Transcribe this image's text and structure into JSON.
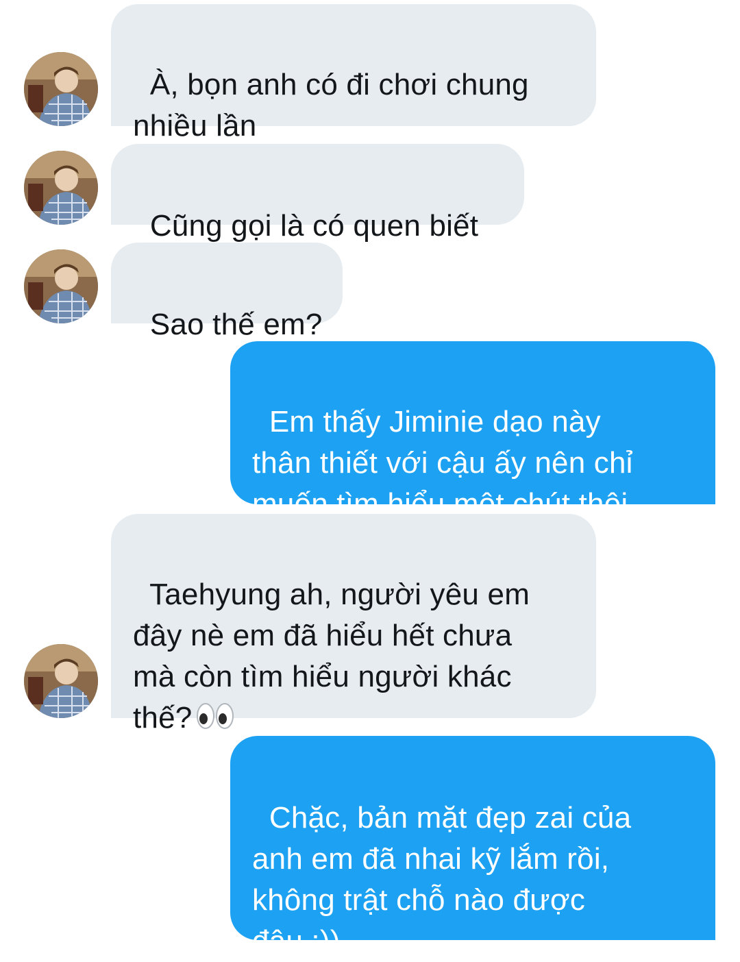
{
  "conversation": {
    "messages": [
      {
        "side": "incoming",
        "text": "À, bọn anh có đi chơi chung\nnhiều lần"
      },
      {
        "side": "incoming",
        "text": "Cũng gọi là có quen biết"
      },
      {
        "side": "incoming",
        "text": "Sao thế em?"
      },
      {
        "side": "outgoing",
        "text": "Em thấy Jiminie dạo này\nthân thiết với cậu ấy nên chỉ\nmuốn tìm hiểu một chút thôi"
      },
      {
        "side": "incoming",
        "text": "Taehyung ah, người yêu em\nđây nè em đã hiểu hết chưa\nmà còn tìm hiểu người khác\nthế?"
      },
      {
        "side": "outgoing",
        "text": "Chặc, bản mặt đẹp zai của\nanh em đã nhai kỹ lắm rồi,\nkhông trật chỗ nào được\nđâu :))"
      }
    ],
    "emoji_icon": "eyes-emoji-icon"
  },
  "colors": {
    "incoming_bubble": "#e6ecf0",
    "outgoing_bubble": "#1da1f2",
    "incoming_text": "#14171a",
    "outgoing_text": "#ffffff"
  }
}
